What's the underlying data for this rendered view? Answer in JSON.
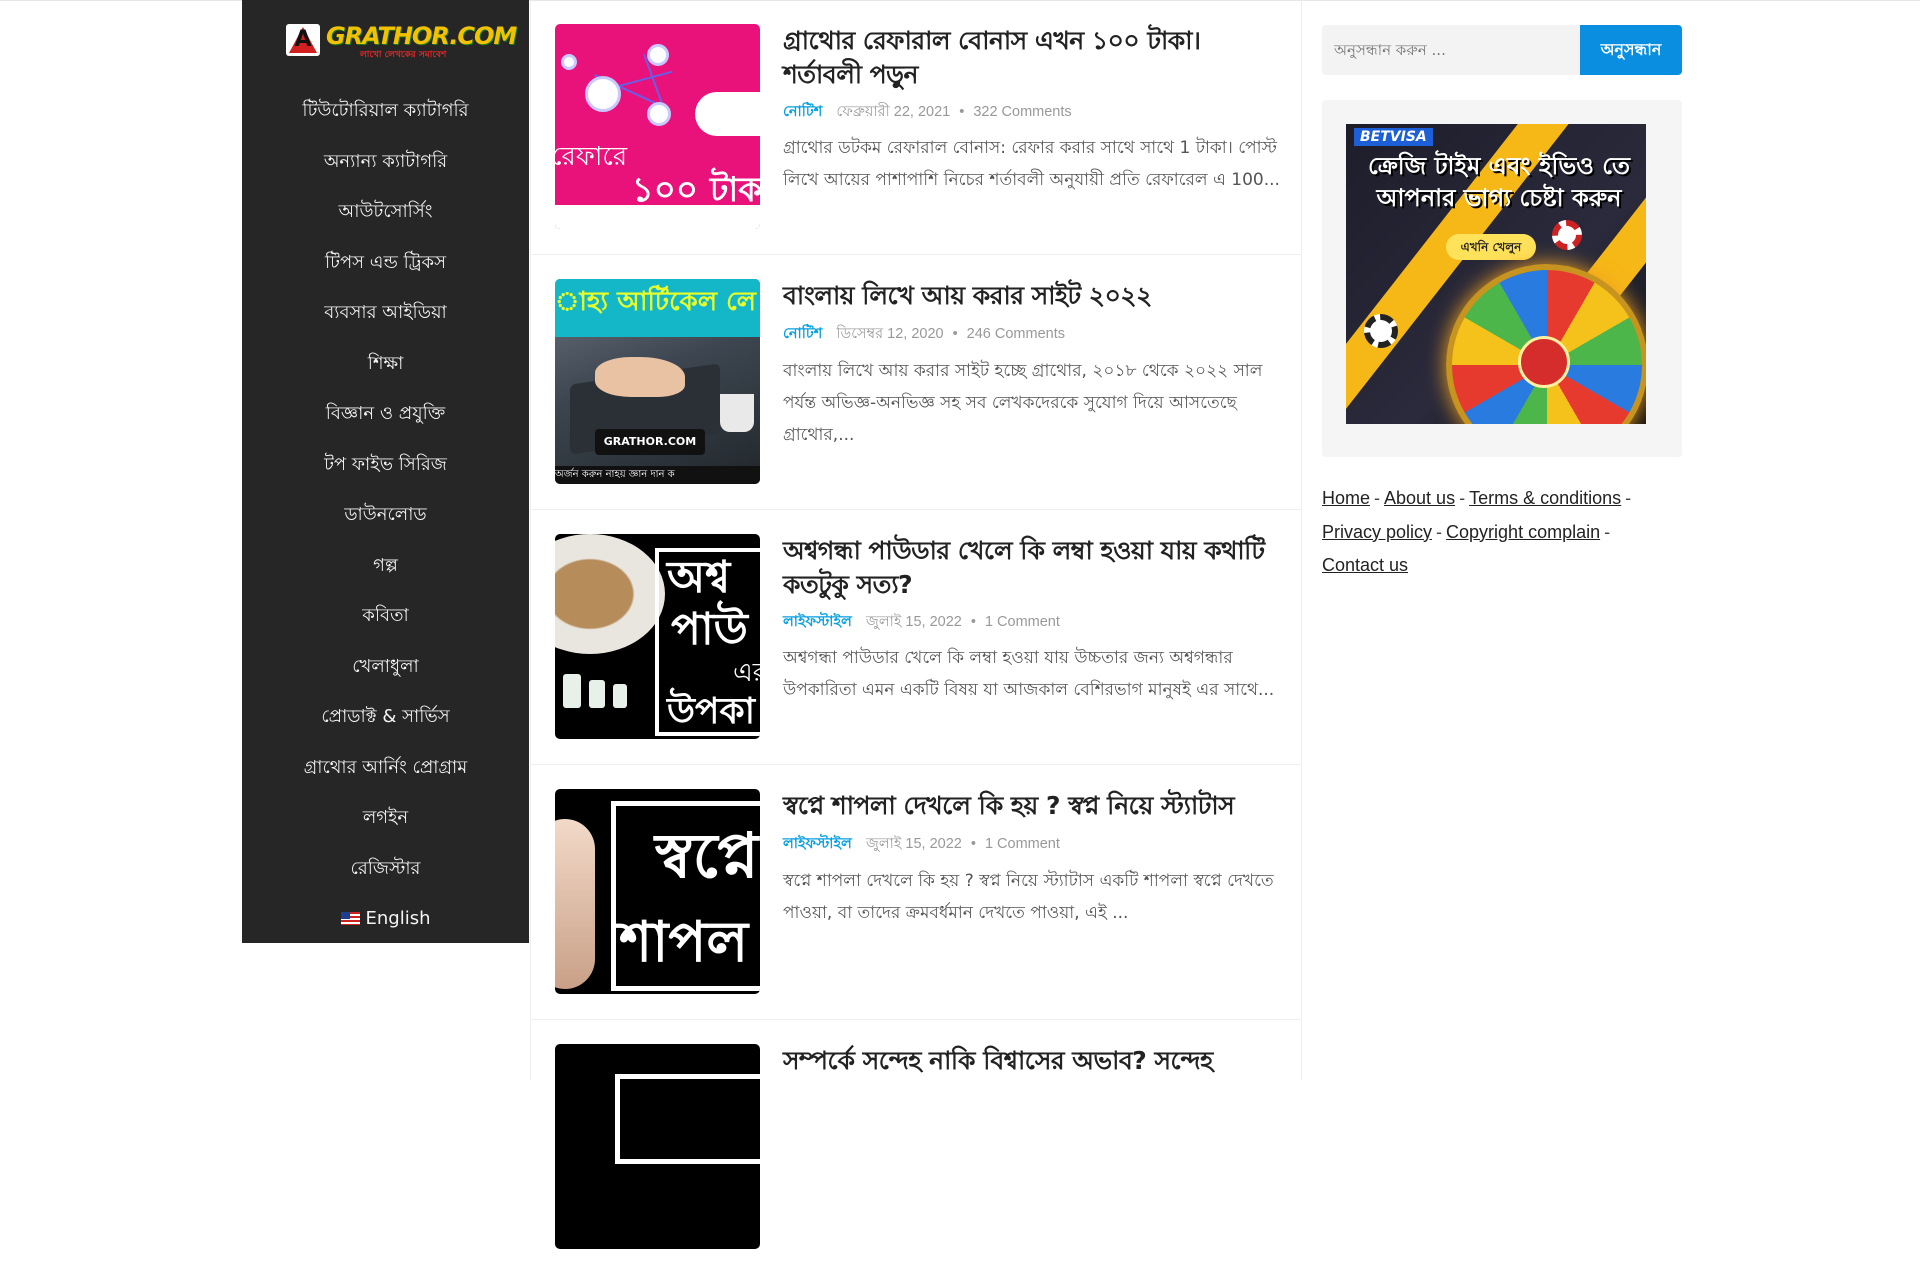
{
  "site": {
    "logo_text": "GRATHOR.COM",
    "logo_tagline": "লাখো লেখকের সমাবেশ"
  },
  "nav": {
    "items": [
      "টিউটোরিয়াল ক্যাটাগরি",
      "অন্যান্য ক্যাটাগরি",
      "আউটসোর্সিং",
      "টিপস এন্ড ট্রিকস",
      "ব্যবসার আইডিয়া",
      "শিক্ষা",
      "বিজ্ঞান ও প্রযুক্তি",
      "টপ ফাইভ সিরিজ",
      "ডাউনলোড",
      "গল্প",
      "কবিতা",
      "খেলাধুলা",
      "প্রোডাক্ট & সার্ভিস",
      "গ্রাথোর আর্নিং প্রোগ্রাম",
      "লগইন",
      "রেজিস্টার"
    ],
    "language": "English"
  },
  "posts": [
    {
      "title": "গ্রাথোর রেফারাল বোনাস এখন ১০০ টাকা। শর্তাবলী পড়ুন",
      "category": "নোটিশ",
      "date": "ফেব্রুয়ারী 22, 2021",
      "comments": "322 Comments",
      "excerpt": "গ্রাথোর ডটকম রেফারাল বোনাস: রেফার করার সাথে সাথে 1 টাকা। পোস্ট লিখে আয়ের পাশাপাশি নিচের শর্তাবলী অনুযায়ী প্রতি রেফারেল এ 100...",
      "thumb_text": [
        "রেফারে",
        "১০০ টাক"
      ]
    },
    {
      "title": "বাংলায় লিখে আয় করার সাইট ২০২২",
      "category": "নোটিশ",
      "date": "ডিসেম্বর 12, 2020",
      "comments": "246 Comments",
      "excerpt": "বাংলায় লিখে আয় করার সাইট হচ্ছে গ্রাথোর, ২০১৮ থেকে ২০২২ সাল পর্যন্ত অভিজ্ঞ-অনভিজ্ঞ সহ সব লেখকদেরকে সুযোগ দিয়ে আসতেছে গ্রাথোর,...",
      "thumb_text": [
        "াহ্য আর্টিকেল লে",
        "GRATHOR.COM",
        "অর্জন করুন নাহয় জ্ঞান দান ক"
      ]
    },
    {
      "title": "অশ্বগন্ধা পাউডার খেলে কি লম্বা হওয়া যায় কথাটি কতটুকু সত্য?",
      "category": "লাইফস্টাইল",
      "date": "জুলাই 15, 2022",
      "comments": "1 Comment",
      "excerpt": "অশ্বগন্ধা পাউডার খেলে কি লম্বা হওয়া যায় উচ্চতার জন্য অশ্বগন্ধার উপকারিতা এমন একটি বিষয় যা আজকাল বেশিরভাগ মানুষই এর সাথে...",
      "thumb_text": [
        "অশ্ব",
        "পাউ",
        "এর",
        "উপকা"
      ]
    },
    {
      "title": "স্বপ্নে শাপলা দেখলে কি হয় ? স্বপ্ন নিয়ে স্ট্যাটাস",
      "category": "লাইফস্টাইল",
      "date": "জুলাই 15, 2022",
      "comments": "1 Comment",
      "excerpt": "স্বপ্নে শাপলা দেখলে কি হয় ? স্বপ্ন নিয়ে স্ট্যাটাস একটি শাপলা স্বপ্নে দেখতে পাওয়া, বা তাদের ক্রমবর্ধমান দেখতে পাওয়া, এই ...",
      "thumb_text": [
        "স্বপ্নে",
        "শাপল"
      ]
    },
    {
      "title": "সম্পর্কে সন্দেহ নাকি বিশ্বাসের অভাব? সন্দেহ"
    }
  ],
  "search": {
    "placeholder": "অনুসন্ধান করুন ...",
    "button": "অনুসন্ধান"
  },
  "ad": {
    "brand": "BETVISA",
    "headline": "ক্রেজি টাইম এবং ইভিও তে আপনার ভাগ্য চেষ্টা করুন",
    "cta": "এখনি খেলুন"
  },
  "footer_links": [
    "Home",
    "About us",
    "Terms & conditions",
    "Privacy policy",
    "Copyright complain",
    "Contact us"
  ],
  "colors": {
    "sidebar_bg": "#262626",
    "accent": "#0a8fe0",
    "category": "#0aa0e0"
  }
}
